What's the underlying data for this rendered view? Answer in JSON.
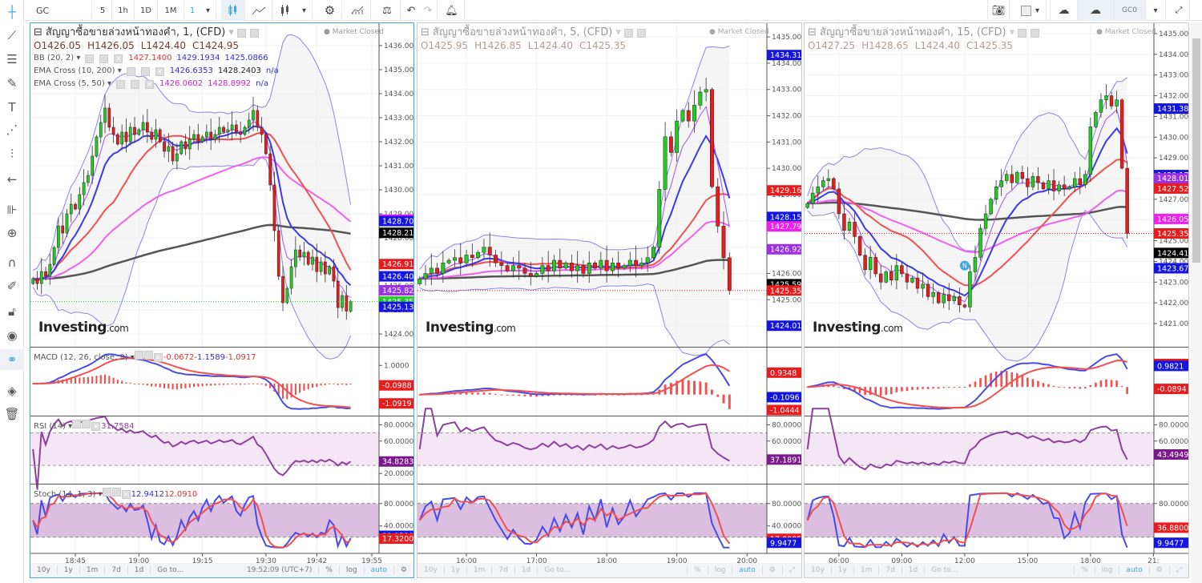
{
  "toolbar": {
    "symbol": "GC",
    "intervals": [
      "5",
      "1h",
      "1D",
      "1M",
      "1"
    ],
    "active_interval": "1",
    "right_symbol": "GC0"
  },
  "colors": {
    "bull": "#22cc22",
    "bear": "#e81c1c",
    "bb_band": "#8b86e6",
    "bb_basis": "#f05050",
    "ema_fast": "#3a3ae8",
    "ema_slow": "#555555",
    "ema5": "#a450f0",
    "ema50": "#f060f0",
    "accent": "#3fa7dd"
  },
  "panels": [
    {
      "title": "สัญญาซื้อขายล่วงหน้าทองคำ, 1, (CFD)",
      "market_status": "Market Closed",
      "ohlc": {
        "o": "O1426.05",
        "h": "H1426.05",
        "l": "L1424.40",
        "c": "C1424.95"
      },
      "studies": [
        {
          "name": "BB (20, 2)",
          "values": [
            {
              "v": "1427.1400",
              "c": "#e03030"
            },
            {
              "v": "1429.1934",
              "c": "#3030d0"
            },
            {
              "v": "1425.0866",
              "c": "#3030d0"
            }
          ]
        },
        {
          "name": "EMA Cross (10, 200)",
          "values": [
            {
              "v": "1426.6353",
              "c": "#3030d0"
            },
            {
              "v": "1428.2403",
              "c": "#222"
            },
            {
              "v": "n/a",
              "c": "#3030d0"
            }
          ]
        },
        {
          "name": "EMA Cross (5, 50)",
          "values": [
            {
              "v": "1426.0602",
              "c": "#d020d0"
            },
            {
              "v": "1428.8992",
              "c": "#d020d0"
            },
            {
              "v": "n/a",
              "c": "#3030d0"
            }
          ]
        }
      ],
      "macd_legend": {
        "name": "MACD (12, 26, close, 9)",
        "values": [
          {
            "v": "-0.0672",
            "c": "#e03030"
          },
          {
            "v": "-1.1589",
            "c": "#3030d0"
          },
          {
            "v": "-1.0917",
            "c": "#e03030"
          }
        ]
      },
      "rsi_legend": {
        "name": "RSI (14)",
        "values": [
          {
            "v": "31.7584",
            "c": "#8e3fa0"
          }
        ]
      },
      "stoch_legend": {
        "name": "Stoch (14, 1, 3)",
        "values": [
          {
            "v": "12.9412",
            "c": "#3030d0"
          },
          {
            "v": "12.0910",
            "c": "#e03030"
          }
        ]
      },
      "price_range": [
        1423.47,
        1436.93
      ],
      "bar_range": [
        -0.6,
        81.7
      ],
      "price_ticks": [
        "1424.00",
        "1425.00",
        "1426.00",
        "1427.00",
        "1428.00",
        "1429.00",
        "1430.00",
        "1431.00",
        "1432.00",
        "1433.00",
        "1434.00",
        "1435.00",
        "1436.00"
      ],
      "last_line_color": "#22cc22",
      "price_labels": [
        {
          "v": "1428.76",
          "bg": "#f020f0"
        },
        {
          "v": "1428.70",
          "bg": "#1515e0"
        },
        {
          "v": "1428.21",
          "bg": "#000000"
        },
        {
          "v": "1426.91",
          "bg": "#e81c1c"
        },
        {
          "v": "1426.40",
          "bg": "#1515e0"
        },
        {
          "v": "1425.82",
          "bg": "#9a30e8"
        },
        {
          "v": "1425.35",
          "bg": "#22cc22"
        },
        {
          "v": "1425.13",
          "bg": "#1515e0"
        }
      ],
      "macd_ticks": [
        "1.0000"
      ],
      "macd_labels": [
        {
          "v": "-0.0988",
          "bg": "#e81c1c"
        },
        {
          "v": "-1.0919",
          "bg": "#e81c1c"
        }
      ],
      "rsi_ticks": [
        "80.0000",
        "60.0000",
        "20.0000"
      ],
      "rsi_label": {
        "v": "34.8283",
        "bg": "#7a1a8a"
      },
      "stoch_ticks": [
        "80.0000",
        "40.0000"
      ],
      "stoch_labels": [
        {
          "v": "22.3529",
          "bg": "#1515e0"
        },
        {
          "v": "17.3200",
          "bg": "#e81c1c"
        }
      ],
      "time_ticks": [
        {
          "t": "18:45",
          "bar": 10
        },
        {
          "t": "19:00",
          "bar": 25
        },
        {
          "t": "19:15",
          "bar": 40
        },
        {
          "t": "19:30",
          "bar": 55
        },
        {
          "t": "19:42",
          "bar": 67
        },
        {
          "t": "19:55",
          "bar": 80
        }
      ],
      "bottom": {
        "items": [
          "10y",
          "1y",
          "1m",
          "7d",
          "1d",
          "Go to..."
        ],
        "clock": "19:52:09 (UTC+7)",
        "pct": "%",
        "log": "log",
        "auto": "auto"
      },
      "closes": [
        1426.3,
        1426.1,
        1426.6,
        1426.4,
        1426.9,
        1427.6,
        1428.5,
        1428.2,
        1429.0,
        1429.4,
        1429.2,
        1429.8,
        1430.3,
        1430.6,
        1431.4,
        1432.2,
        1432.8,
        1433.4,
        1432.6,
        1432.3,
        1431.9,
        1432.4,
        1432.0,
        1432.6,
        1432.3,
        1432.5,
        1432.8,
        1432.4,
        1432.1,
        1432.5,
        1432.0,
        1431.6,
        1431.8,
        1431.2,
        1431.5,
        1432.0,
        1431.7,
        1432.1,
        1432.3,
        1432.0,
        1432.2,
        1432.4,
        1432.1,
        1432.3,
        1432.6,
        1432.4,
        1432.5,
        1432.7,
        1432.4,
        1432.3,
        1432.6,
        1432.9,
        1433.3,
        1432.6,
        1432.3,
        1431.5,
        1430.2,
        1428.3,
        1426.4,
        1425.3,
        1425.9,
        1426.8,
        1427.5,
        1427.2,
        1427.4,
        1426.9,
        1427.2,
        1426.6,
        1427.0,
        1426.5,
        1426.8,
        1426.2,
        1425.1,
        1425.6,
        1424.95,
        1425.35
      ]
    },
    {
      "title": "สัญญาซื้อขายล่วงหน้าทองคำ, 5, (CFD)",
      "market_status": "Market Closed",
      "ohlc": {
        "o": "O1425.95",
        "h": "H1426.85",
        "l": "L1424.40",
        "c": "C1425.35"
      },
      "price_range": [
        1423.21,
        1435.52
      ],
      "bar_range": [
        -0.37,
        59.4
      ],
      "price_ticks": [
        "1424.00",
        "1425.00",
        "1426.00",
        "1427.00",
        "1428.00",
        "1429.00",
        "1430.00",
        "1431.00",
        "1432.00",
        "1433.00",
        "1434.00",
        "1435.00"
      ],
      "last_line_color": "#e81c1c",
      "price_labels": [
        {
          "v": "1434.31",
          "bg": "#1515e0"
        },
        {
          "v": "1429.16",
          "bg": "#e81c1c"
        },
        {
          "v": "1428.15",
          "bg": "#1515e0"
        },
        {
          "v": "1427.79",
          "bg": "#f020f0"
        },
        {
          "v": "1426.92",
          "bg": "#9a30e8"
        },
        {
          "v": "1425.59",
          "bg": "#000000"
        },
        {
          "v": "1425.35",
          "bg": "#e81c1c"
        },
        {
          "v": "1424.01",
          "bg": "#1515e0"
        }
      ],
      "macd_ticks": [],
      "macd_labels": [
        {
          "v": "0.9348",
          "bg": "#e81c1c"
        },
        {
          "v": "-0.1096",
          "bg": "#1515e0"
        },
        {
          "v": "-1.0444",
          "bg": "#e81c1c"
        }
      ],
      "rsi_ticks": [
        "80.0000",
        "60.0000"
      ],
      "rsi_label": {
        "v": "37.1891",
        "bg": "#7a1a8a"
      },
      "stoch_ticks": [
        "80.0000",
        "40.0000"
      ],
      "stoch_labels": [
        {
          "v": "17.0005",
          "bg": "#e81c1c"
        },
        {
          "v": "9.9477",
          "bg": "#1515e0"
        }
      ],
      "time_ticks": [
        {
          "t": "16:00",
          "bar": 8
        },
        {
          "t": "17:00",
          "bar": 20
        },
        {
          "t": "18:00",
          "bar": 32
        },
        {
          "t": "19:00",
          "bar": 44
        },
        {
          "t": "20:00",
          "bar": 56
        }
      ],
      "bottom": {
        "items": [
          "10y",
          "1y",
          "1m",
          "7d",
          "1d",
          "Go to..."
        ],
        "pct": "%",
        "log": "log",
        "auto": "auto"
      },
      "closes": [
        1425.8,
        1426.0,
        1426.2,
        1426.0,
        1426.4,
        1426.5,
        1426.6,
        1426.4,
        1426.7,
        1426.6,
        1426.8,
        1427.0,
        1426.7,
        1426.4,
        1426.3,
        1426.1,
        1426.3,
        1426.2,
        1426.0,
        1425.9,
        1426.0,
        1426.3,
        1426.1,
        1426.5,
        1426.2,
        1426.4,
        1426.1,
        1426.3,
        1426.0,
        1426.4,
        1426.2,
        1426.5,
        1426.1,
        1426.4,
        1426.2,
        1426.3,
        1426.5,
        1426.3,
        1426.4,
        1426.6,
        1427.0,
        1429.2,
        1431.2,
        1430.6,
        1431.8,
        1432.2,
        1431.8,
        1432.4,
        1432.9,
        1433.0,
        1429.3,
        1427.8,
        1426.6,
        1425.35
      ]
    },
    {
      "title": "สัญญาซื้อขายล่วงหน้าทองคำ, 15, (CFD)",
      "market_status": "Market Closed",
      "ohlc": {
        "o": "O1427.25",
        "h": "H1428.65",
        "l": "L1424.40",
        "c": "C1425.35"
      },
      "price_range": [
        1419.88,
        1435.5
      ],
      "bar_range": [
        -0.56,
        66.1
      ],
      "price_ticks": [
        "1421.00",
        "1422.00",
        "1423.00",
        "1424.00",
        "1425.00",
        "1426.00",
        "1427.00",
        "1428.00",
        "1429.00",
        "1430.00",
        "1431.00",
        "1432.00",
        "1433.00",
        "1434.00",
        "1435.00"
      ],
      "last_line_color": "#e81c1c",
      "price_labels": [
        {
          "v": "1431.38",
          "bg": "#1515e0"
        },
        {
          "v": "1428.17",
          "bg": "#1515e0"
        },
        {
          "v": "1428.01",
          "bg": "#9a30e8"
        },
        {
          "v": "1427.52",
          "bg": "#e81c1c"
        },
        {
          "v": "1426.05",
          "bg": "#f020f0"
        },
        {
          "v": "1425.35",
          "bg": "#e81c1c"
        },
        {
          "v": "1424.41",
          "bg": "#000000"
        },
        {
          "v": "1423.67",
          "bg": "#1515e0"
        }
      ],
      "macd_ticks": [],
      "macd_labels": [
        {
          "v": "1.0715",
          "bg": "#e81c1c"
        },
        {
          "v": "0.9821",
          "bg": "#1515e0"
        },
        {
          "v": "-0.0894",
          "bg": "#e81c1c"
        }
      ],
      "rsi_ticks": [
        "80.0000",
        "60.0000"
      ],
      "rsi_label": {
        "v": "43.4949",
        "bg": "#7a1a8a"
      },
      "stoch_ticks": [
        "80.0000"
      ],
      "stoch_labels": [
        {
          "v": "36.8800",
          "bg": "#e81c1c"
        },
        {
          "v": "9.9477",
          "bg": "#1515e0"
        }
      ],
      "time_ticks": [
        {
          "t": "06:00",
          "bar": 6
        },
        {
          "t": "09:00",
          "bar": 18
        },
        {
          "t": "12:00",
          "bar": 30
        },
        {
          "t": "15:00",
          "bar": 42
        },
        {
          "t": "18:00",
          "bar": 54
        },
        {
          "t": "21:",
          "bar": 66
        }
      ],
      "event_marker": {
        "label": "N",
        "bar": 30
      },
      "bottom": {
        "items": [
          "10y",
          "1y",
          "1m",
          "7d",
          "1d",
          "Go to..."
        ],
        "pct": "%",
        "log": "log",
        "auto": "auto"
      },
      "closes": [
        1426.8,
        1427.3,
        1427.6,
        1427.9,
        1428.0,
        1427.5,
        1426.3,
        1425.5,
        1425.9,
        1425.2,
        1424.3,
        1423.6,
        1424.2,
        1423.4,
        1423.0,
        1423.5,
        1423.1,
        1423.8,
        1423.4,
        1423.0,
        1423.2,
        1422.7,
        1422.9,
        1422.3,
        1422.5,
        1422.0,
        1422.4,
        1422.1,
        1422.3,
        1421.9,
        1421.8,
        1423.5,
        1424.2,
        1425.6,
        1426.3,
        1427.0,
        1427.6,
        1427.9,
        1428.2,
        1427.8,
        1428.3,
        1428.0,
        1427.6,
        1428.1,
        1427.8,
        1427.5,
        1427.9,
        1427.4,
        1427.7,
        1427.5,
        1427.6,
        1428.0,
        1427.7,
        1428.2,
        1430.5,
        1431.2,
        1431.8,
        1432.0,
        1431.5,
        1431.8,
        1428.5,
        1425.35
      ]
    }
  ],
  "watermark": {
    "brand": "Investing",
    "suffix": ".com"
  }
}
